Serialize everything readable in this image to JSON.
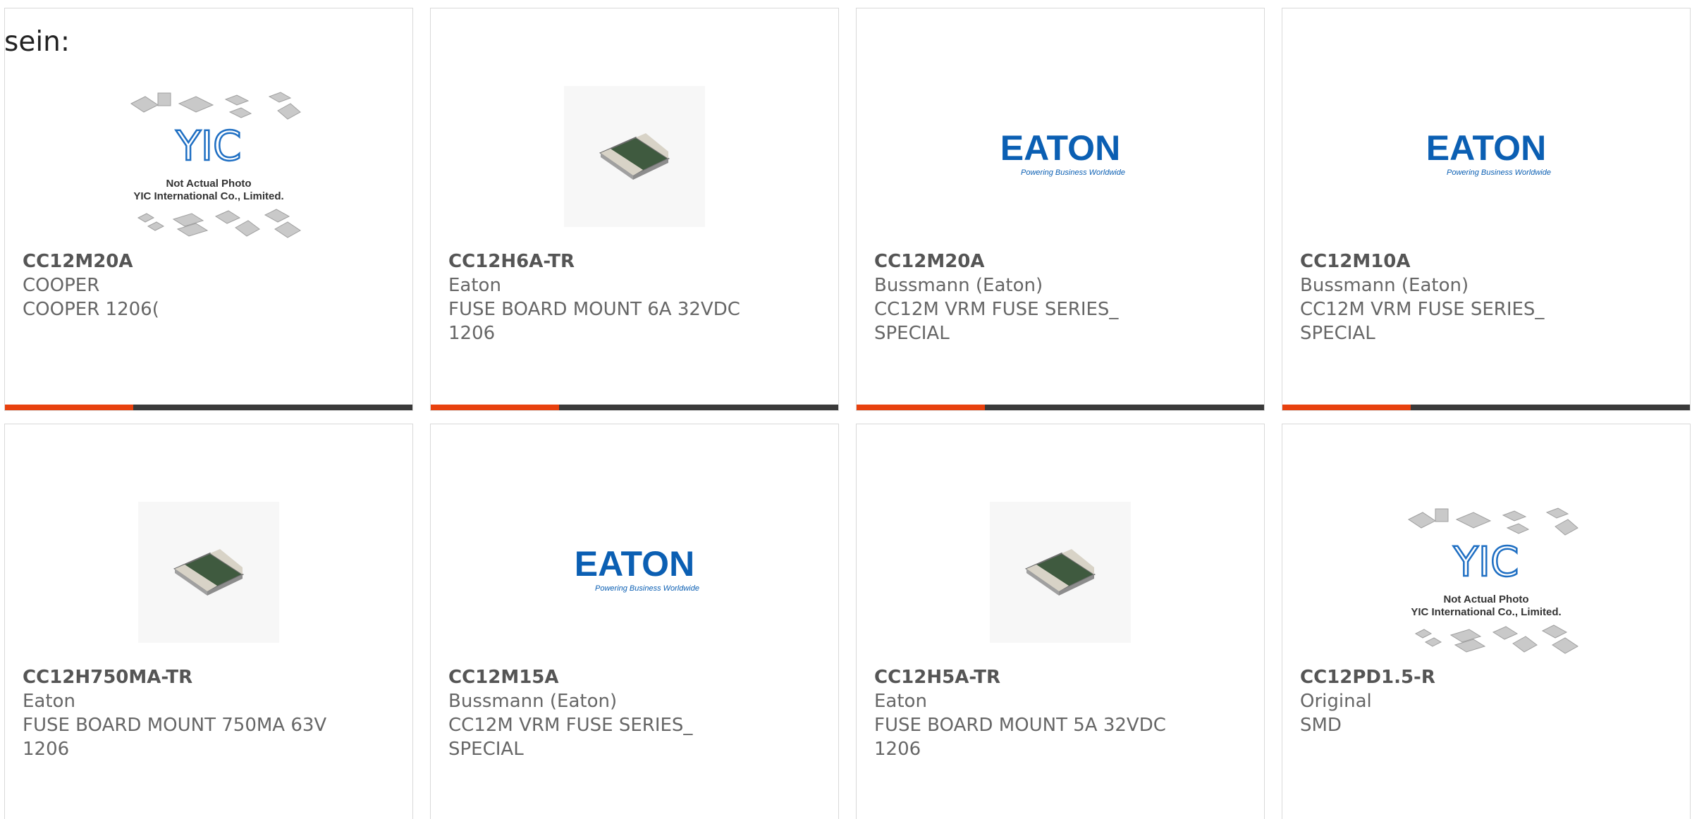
{
  "page": {
    "lead_text": "sein:"
  },
  "colors": {
    "accent": "#e8410e",
    "bar_dark": "#3a3a3a",
    "eaton_blue": "#0b5fb3",
    "yic_blue": "#1f6fc3"
  },
  "products": [
    {
      "part_number": "CC12M20A",
      "manufacturer": "COOPER",
      "description": "COOPER 1206(",
      "image": "yic-not-actual-photo",
      "image_caption_line1": "Not Actual Photo",
      "image_caption_line2": "YIC International Co., Limited.",
      "logo_text": "YIC"
    },
    {
      "part_number": "CC12H6A-TR",
      "manufacturer": "Eaton",
      "description": "FUSE BOARD MOUNT 6A 32VDC\n1206",
      "image": "smd-fuse-chip"
    },
    {
      "part_number": "CC12M20A",
      "manufacturer": "Bussmann (Eaton)",
      "description": "CC12M VRM FUSE SERIES_\nSPECIAL",
      "image": "eaton-logo",
      "logo_text": "EATON",
      "logo_tagline": "Powering Business Worldwide"
    },
    {
      "part_number": "CC12M10A",
      "manufacturer": "Bussmann (Eaton)",
      "description": "CC12M VRM FUSE SERIES_\nSPECIAL",
      "image": "eaton-logo",
      "logo_text": "EATON",
      "logo_tagline": "Powering Business Worldwide"
    },
    {
      "part_number": "CC12H750MA-TR",
      "manufacturer": "Eaton",
      "description": "FUSE BOARD MOUNT 750MA 63V\n1206",
      "image": "smd-fuse-chip"
    },
    {
      "part_number": "CC12M15A",
      "manufacturer": "Bussmann (Eaton)",
      "description": "CC12M VRM FUSE SERIES_\nSPECIAL",
      "image": "eaton-logo",
      "logo_text": "EATON",
      "logo_tagline": "Powering Business Worldwide"
    },
    {
      "part_number": "CC12H5A-TR",
      "manufacturer": "Eaton",
      "description": "FUSE BOARD MOUNT 5A 32VDC\n1206",
      "image": "smd-fuse-chip"
    },
    {
      "part_number": "CC12PD1.5-R",
      "manufacturer": "Original",
      "description": "SMD",
      "image": "yic-not-actual-photo",
      "image_caption_line1": "Not Actual Photo",
      "image_caption_line2": "YIC International Co., Limited.",
      "logo_text": "YIC"
    }
  ]
}
